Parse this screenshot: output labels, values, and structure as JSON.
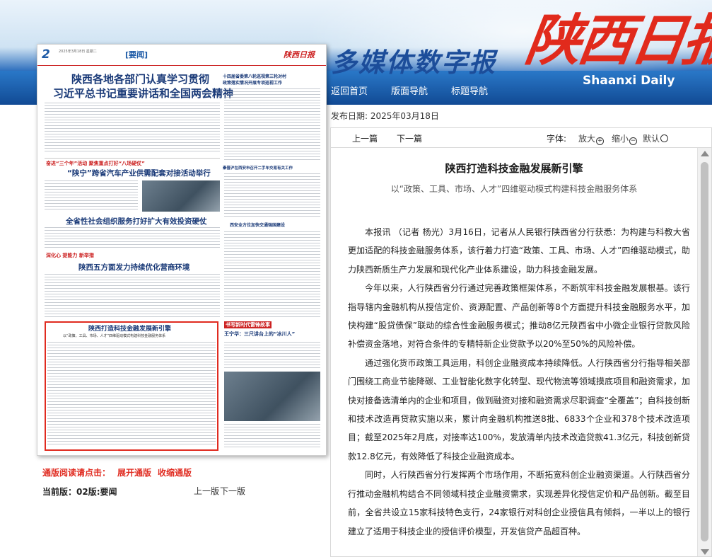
{
  "header": {
    "media_title": "多媒体数字报",
    "brand_cn": "陕西日报",
    "brand_en": "Shaanxi Daily",
    "nav": [
      "返回首页",
      "版面导航",
      "标题导航"
    ]
  },
  "page_thumbnail": {
    "page_number": "2",
    "page_date": "2025年3月18日 星期二",
    "section": "[要闻]",
    "logo_text": "陕西日报",
    "headlines": [
      "陕西各地各部门认真学习贯彻",
      "习近平总书记重要讲话和全国两会精神",
      "“陕宁”跨省汽车产业供需配套对接活动举行",
      "全省性社会组织服务打好扩大有效投资硬仗",
      "陕西五方面发力持续优化营商环境",
      "陕西打造科技金融发展新引擎",
      "以“政策、工具、市场、人才”四维驱动模式构建科技金融服务体系"
    ],
    "side_headlines": [
      "十四届省委第八轮巡视第三轮对村",
      "政策落实情况开展专项巡视工作",
      "秦晋沪在西安市召开二手车交易有关工作",
      "西安全方位加快交通强国建设",
      "王宁华：三尺讲台上的“冰川人”"
    ],
    "tags": [
      "奋进“三个年”活动  聚焦重点打好“八场硬仗”",
      "深化心  提能力  新举措",
      "书写新时代雷锋故事"
    ]
  },
  "edition_controls": {
    "read_point_label": "通版阅读请点击：",
    "expand_label": "展开通版",
    "collapse_label": "收缩通版",
    "current_edition": "当前版：02版:要闻",
    "prev_edition": "上一版",
    "next_edition": "下一版"
  },
  "article_meta": {
    "publish_date": "发布日期:  2025年03月18日"
  },
  "article_toolbar": {
    "prev_article": "上一篇",
    "next_article": "下一篇",
    "font_label": "字体:",
    "font_large": "放大",
    "font_small": "缩小",
    "font_default": "默认",
    "icons": {
      "large": "zoom-in-icon",
      "small": "zoom-out-icon",
      "default": "reset-icon"
    }
  },
  "article": {
    "title": "陕西打造科技金融发展新引擎",
    "subtitle": "以“政策、工具、市场、人才”四维驱动模式构建科技金融服务体系",
    "paragraphs": [
      "本报讯  （记者 杨光）3月16日，记者从人民银行陕西省分行获悉：为构建与科教大省更加适配的科技金融服务体系，该行着力打造“政策、工具、市场、人才”四维驱动模式，助力陕西新质生产力发展和现代化产业体系建设，助力科技金融发展。",
      "今年以来，人行陕西省分行通过完善政策框架体系，不断筑牢科技金融发展根基。该行指导辖内金融机构从授信定价、资源配置、产品创新等8个方面提升科技金融服务水平，加快构建“股贷债保”联动的综合性金融服务模式；推动8亿元陕西省中小微企业银行贷款风险补偿资金落地，对符合条件的专精特新企业贷款予以20%至50%的风险补偿。",
      "通过强化货币政策工具运用，科创企业融资成本持续降低。人行陕西省分行指导相关部门围绕工商业节能降碳、工业智能化数字化转型、现代物流等领域摸底项目和融资需求，加快对接备选清单内的企业和项目，做到融资对接和融资需求尽职调查“全覆盖”；自科技创新和技术改造再贷款实施以来，累计向金融机构推送8批、6833个企业和378个技术改造项目；截至2025年2月底，对接率达100%，发放清单内技术改造贷款41.3亿元，科技创新贷款12.8亿元，有效降低了科技企业融资成本。",
      "同时，人行陕西省分行发挥两个市场作用，不断拓宽科创企业融资渠道。人行陕西省分行推动金融机构结合不同领域科技企业融资需求，实现差异化授信定价和产品创新。截至目前，全省共设立15家科技特色支行，24家银行对科创企业授信具有倾斜，一半以上的银行建立了适用于科技企业的授信评价模型，开发信贷产品超百种。"
    ]
  }
}
